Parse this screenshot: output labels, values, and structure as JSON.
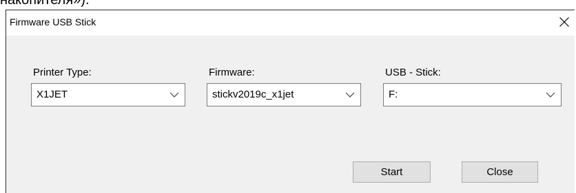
{
  "background": {
    "text": "накопителя»)."
  },
  "window": {
    "title": "Firmware USB Stick",
    "close_glyph": "×"
  },
  "fields": {
    "printer_type": {
      "label": "Printer Type:",
      "value": "X1JET"
    },
    "firmware": {
      "label": "Firmware:",
      "value": "stickv2019c_x1jet"
    },
    "usb_stick": {
      "label": "USB - Stick:",
      "value": "F:"
    }
  },
  "buttons": {
    "start": "Start",
    "close": "Close"
  },
  "icons": {
    "close": "close-icon",
    "dropdown": "chevron-down-icon"
  },
  "colors": {
    "window_bg": "#f0f0f0",
    "titlebar_bg": "#ffffff",
    "button_bg": "#e1e1e1",
    "button_border": "#adadad",
    "combo_border": "#7a7a7a"
  }
}
